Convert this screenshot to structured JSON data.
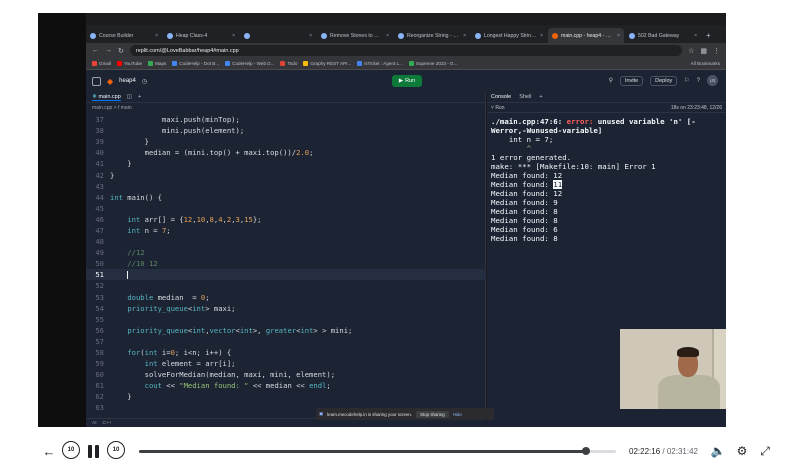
{
  "browser": {
    "tabs": [
      {
        "title": "Course Builder",
        "active": false
      },
      {
        "title": "Heap Class-4",
        "active": false
      },
      {
        "title": "",
        "active": false
      },
      {
        "title": "Remove Stones to Minimiz",
        "active": false
      },
      {
        "title": "Reorganize String - LeetCo",
        "active": false
      },
      {
        "title": "Longest Happy String - Lee",
        "active": false
      },
      {
        "title": "main.cpp - heap4 - Replit",
        "active": true
      },
      {
        "title": "502 Bad Gateway",
        "active": false
      }
    ],
    "url": "replit.com/@LoveBabbar/heap4#main.cpp",
    "bookmarks": [
      "Gmail",
      "YouTube",
      "Maps",
      "CodeHelp - Dot B...",
      "CodeHelp - Web D...",
      "Todo",
      "Graphy REST API...",
      "isTicket : Agent L...",
      "Supreme 2023 - G..."
    ],
    "all_bookmarks": "All Bookmarks"
  },
  "replit": {
    "repl_name": "heap4",
    "run_label": "Run",
    "invite_label": "Invite",
    "deploy_label": "Deploy",
    "avatar_initials": "LB"
  },
  "editor": {
    "tab_label": "main.cpp",
    "breadcrumb": "main.cpp > f main",
    "lines": [
      {
        "n": "37",
        "text": "            maxi.push(minTop);"
      },
      {
        "n": "38",
        "text": "            mini.push(element);"
      },
      {
        "n": "39",
        "text": "        }"
      },
      {
        "n": "40",
        "text": "        median = (mini.top() + maxi.top())/2.0;"
      },
      {
        "n": "41",
        "text": "    }"
      },
      {
        "n": "42",
        "text": "}"
      },
      {
        "n": "43",
        "text": ""
      },
      {
        "n": "44",
        "text": "int main() {"
      },
      {
        "n": "45",
        "text": ""
      },
      {
        "n": "46",
        "text": "    int arr[] = {12,10,8,4,2,3,15};"
      },
      {
        "n": "47",
        "text": "    int n = 7;"
      },
      {
        "n": "48",
        "text": ""
      },
      {
        "n": "49",
        "text": "    //12"
      },
      {
        "n": "50",
        "text": "    //10 12"
      },
      {
        "n": "51",
        "text": "    "
      },
      {
        "n": "52",
        "text": ""
      },
      {
        "n": "53",
        "text": "    double median  = 0;"
      },
      {
        "n": "54",
        "text": "    priority_queue<int> maxi;"
      },
      {
        "n": "55",
        "text": ""
      },
      {
        "n": "56",
        "text": "    priority_queue<int,vector<int>, greater<int> > mini;"
      },
      {
        "n": "57",
        "text": ""
      },
      {
        "n": "58",
        "text": "    for(int i=0; i<n; i++) {"
      },
      {
        "n": "59",
        "text": "        int element = arr[i];"
      },
      {
        "n": "60",
        "text": "        solveForMedian(median, maxi, mini, element);"
      },
      {
        "n": "61",
        "text": "        cout << \"Median found: \" << median << endl;"
      },
      {
        "n": "62",
        "text": "    }"
      },
      {
        "n": "63",
        "text": ""
      }
    ],
    "status_ai": "AI",
    "status_lang": "C++"
  },
  "console": {
    "tab_console": "Console",
    "tab_shell": "Shell",
    "run_label": "Run",
    "run_meta": "18s on 23:23:48, 12/26",
    "error_prefix": "./main.cpp:47:6: ",
    "error_word": "error:",
    "error_message": " unused variable 'n' [-Werror,-Wunused-variable]",
    "error_code_line": "    int n = 7;",
    "error_caret": "        ^",
    "summary": "1 error generated.",
    "make_line": "make: *** [Makefile:10: main] Error 1",
    "medians_before": [
      "Median found: 12"
    ],
    "median_highlight_prefix": "Median found: ",
    "median_highlight_value": "11",
    "medians_after": [
      "Median found: 12",
      "Median found: 9",
      "Median found: 8",
      "Median found: 8",
      "Median found: 6",
      "Median found: 8"
    ]
  },
  "share_bar": {
    "message": "learn.mecodehelp.in is sharing your screen.",
    "stop_label": "Stop sharing",
    "hide_label": "Hide"
  },
  "player": {
    "skip_back_label": "10",
    "skip_fwd_label": "10",
    "current_time": "02:22:16",
    "duration": "02:31:42",
    "progress_fraction": 0.938
  }
}
